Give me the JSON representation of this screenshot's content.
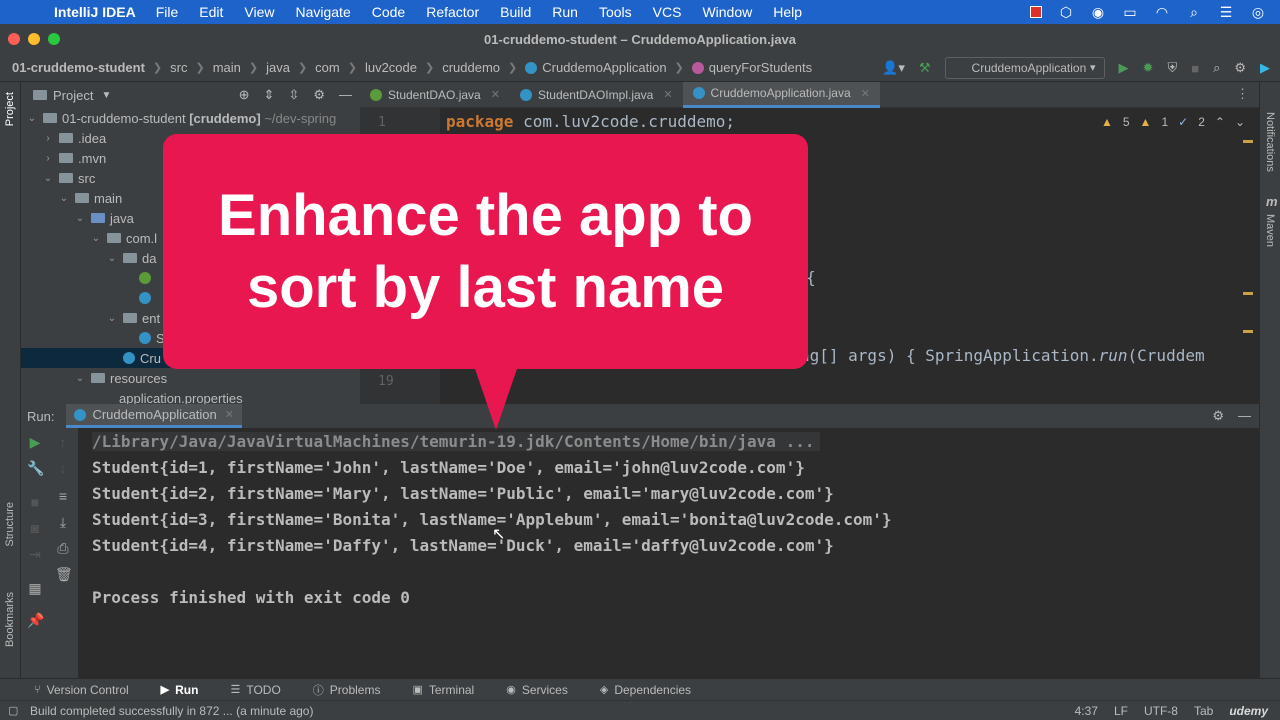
{
  "menubar": {
    "app_name": "IntelliJ IDEA",
    "menus": [
      "File",
      "Edit",
      "View",
      "Navigate",
      "Code",
      "Refactor",
      "Build",
      "Run",
      "Tools",
      "VCS",
      "Window",
      "Help"
    ]
  },
  "window": {
    "title": "01-cruddemo-student – CruddemoApplication.java"
  },
  "breadcrumb": {
    "items": [
      "01-cruddemo-student",
      "src",
      "main",
      "java",
      "com",
      "luv2code",
      "cruddemo",
      "CruddemoApplication",
      "queryForStudents"
    ]
  },
  "toolbar": {
    "run_config": "CruddemoApplication"
  },
  "project": {
    "title": "Project",
    "tree": [
      {
        "label": "01-cruddemo-student",
        "suffix": "[cruddemo]",
        "hint": "~/dev-spring"
      },
      {
        "label": ".idea"
      },
      {
        "label": ".mvn"
      },
      {
        "label": "src"
      },
      {
        "label": "main"
      },
      {
        "label": "java"
      },
      {
        "label": "com.l"
      },
      {
        "label": "da"
      },
      {
        "label": ""
      },
      {
        "label": ""
      },
      {
        "label": "ent"
      },
      {
        "label": "S"
      },
      {
        "label": "Cru"
      },
      {
        "label": "resources"
      },
      {
        "label": "application.properties"
      }
    ]
  },
  "editor": {
    "tabs": [
      {
        "label": "StudentDAO.java",
        "color": "#5b9b3a"
      },
      {
        "label": "StudentDAOImpl.java",
        "color": "#3592c4"
      },
      {
        "label": "CruddemoApplication.java",
        "color": "#3592c4"
      }
    ],
    "line1_no": "1",
    "line19_no": "19",
    "line1_kw": "package",
    "line1_rest": " com.luv2code.cruddemo;",
    "brace_fragment": "{",
    "main_fragment_a": "ng[] args) ",
    "main_fragment_b": "{ ",
    "main_fragment_c": "SpringApplication.",
    "main_fragment_d": "run",
    "main_fragment_e": "(Cruddem",
    "inspections": {
      "warnings": "5",
      "weak": "1",
      "typos": "2"
    }
  },
  "callout": {
    "text": "Enhance the app to sort by last name"
  },
  "run": {
    "label": "Run:",
    "tab": "CruddemoApplication",
    "lines": [
      "/Library/Java/JavaVirtualMachines/temurin-19.jdk/Contents/Home/bin/java ...",
      "Student{id=1, firstName='John', lastName='Doe', email='john@luv2code.com'}",
      "Student{id=2, firstName='Mary', lastName='Public', email='mary@luv2code.com'}",
      "Student{id=3, firstName='Bonita', lastName='Applebum', email='bonita@luv2code.com'}",
      "Student{id=4, firstName='Daffy', lastName='Duck', email='daffy@luv2code.com'}",
      "",
      "Process finished with exit code 0"
    ]
  },
  "side_labels": {
    "project": "Project",
    "structure": "Structure",
    "bookmarks": "Bookmarks",
    "notifications": "Notifications",
    "maven": "Maven",
    "maven_m": "m"
  },
  "bottom_tools": [
    "Version Control",
    "Run",
    "TODO",
    "Problems",
    "Terminal",
    "Services",
    "Dependencies"
  ],
  "status": {
    "message": "Build completed successfully in 872 ... (a minute ago)",
    "position": "4:37",
    "line_sep": "LF",
    "encoding": "UTF-8",
    "indent": "Tab",
    "watermark": "udemy"
  },
  "colors": {
    "accent": "#e8174f",
    "menubar": "#1e63c9",
    "run_green": "#499c54"
  }
}
